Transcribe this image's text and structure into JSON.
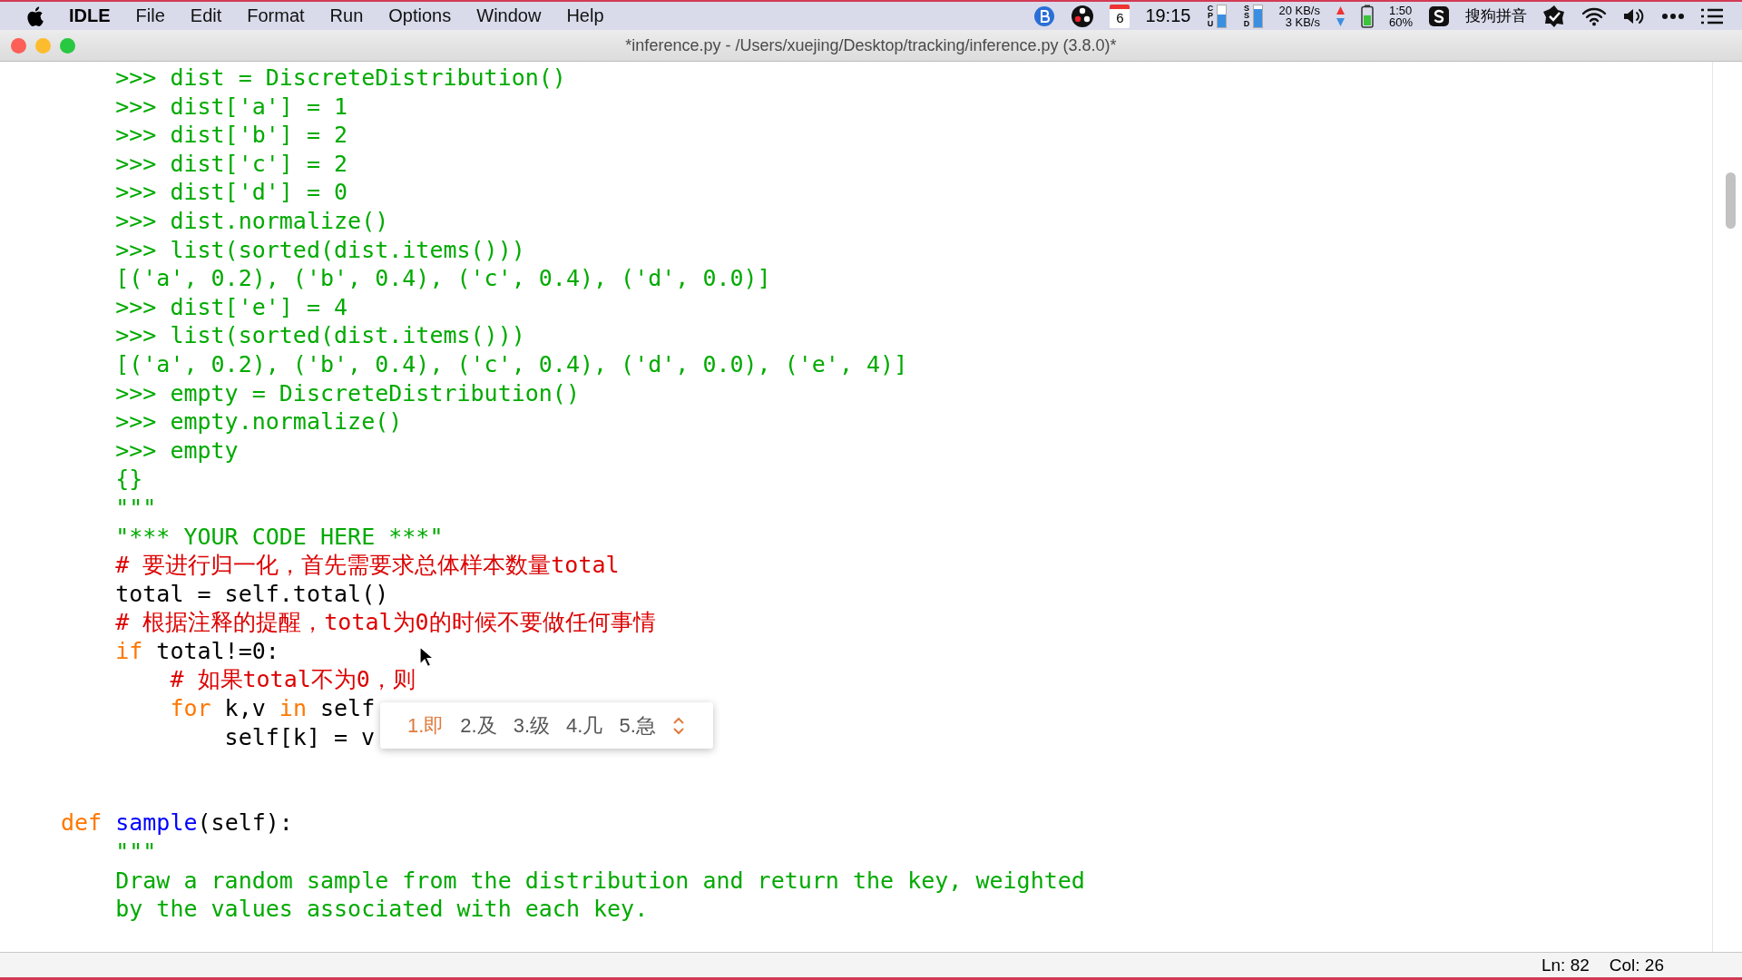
{
  "menu_bar": {
    "app_name": "IDLE",
    "menus": [
      "File",
      "Edit",
      "Format",
      "Run",
      "Options",
      "Window",
      "Help"
    ],
    "status": {
      "calendar_day": "6",
      "clock": "19:15",
      "cpu": {
        "label": "CPU",
        "level": 0.55
      },
      "ssd": {
        "label": "SSD",
        "level": 0.8
      },
      "network": {
        "upload": "20 KB/s",
        "download": "3 KB/s"
      },
      "battery": {
        "level": 0.6,
        "time": "1:50",
        "percent": "60%"
      },
      "input_method": "搜狗拼音"
    }
  },
  "window": {
    "title": "*inference.py - /Users/xuejing/Desktop/tracking/inference.py (3.8.0)*"
  },
  "editor": {
    "lines": [
      {
        "kind": "code",
        "tokens": [
          {
            "kind": "string",
            "text": "    >>> dist = DiscreteDistribution()"
          }
        ]
      },
      {
        "kind": "code",
        "tokens": [
          {
            "kind": "string",
            "text": "    >>> dist['a'] = 1"
          }
        ]
      },
      {
        "kind": "code",
        "tokens": [
          {
            "kind": "string",
            "text": "    >>> dist['b'] = 2"
          }
        ]
      },
      {
        "kind": "code",
        "tokens": [
          {
            "kind": "string",
            "text": "    >>> dist['c'] = 2"
          }
        ]
      },
      {
        "kind": "code",
        "tokens": [
          {
            "kind": "string",
            "text": "    >>> dist['d'] = 0"
          }
        ]
      },
      {
        "kind": "code",
        "tokens": [
          {
            "kind": "string",
            "text": "    >>> dist.normalize()"
          }
        ]
      },
      {
        "kind": "code",
        "tokens": [
          {
            "kind": "string",
            "text": "    >>> list(sorted(dist.items()))"
          }
        ]
      },
      {
        "kind": "code",
        "tokens": [
          {
            "kind": "string",
            "text": "    [('a', 0.2), ('b', 0.4), ('c', 0.4), ('d', 0.0)]"
          }
        ]
      },
      {
        "kind": "code",
        "tokens": [
          {
            "kind": "string",
            "text": "    >>> dist['e'] = 4"
          }
        ]
      },
      {
        "kind": "code",
        "tokens": [
          {
            "kind": "string",
            "text": "    >>> list(sorted(dist.items()))"
          }
        ]
      },
      {
        "kind": "code",
        "tokens": [
          {
            "kind": "string",
            "text": "    [('a', 0.2), ('b', 0.4), ('c', 0.4), ('d', 0.0), ('e', 4)]"
          }
        ]
      },
      {
        "kind": "code",
        "tokens": [
          {
            "kind": "string",
            "text": "    >>> empty = DiscreteDistribution()"
          }
        ]
      },
      {
        "kind": "code",
        "tokens": [
          {
            "kind": "string",
            "text": "    >>> empty.normalize()"
          }
        ]
      },
      {
        "kind": "code",
        "tokens": [
          {
            "kind": "string",
            "text": "    >>> empty"
          }
        ]
      },
      {
        "kind": "code",
        "tokens": [
          {
            "kind": "string",
            "text": "    {}"
          }
        ]
      },
      {
        "kind": "code",
        "tokens": [
          {
            "kind": "string",
            "text": "    \"\"\""
          }
        ]
      },
      {
        "kind": "code",
        "tokens": [
          {
            "kind": "string",
            "text": "    \"*** YOUR CODE HERE ***\""
          }
        ]
      },
      {
        "kind": "code",
        "tokens": [
          {
            "kind": "comment",
            "text": "    # 要进行归一化，首先需要求总体样本数量total"
          }
        ]
      },
      {
        "kind": "code",
        "tokens": [
          {
            "kind": "plain",
            "text": "    total = self.total()"
          }
        ]
      },
      {
        "kind": "code",
        "tokens": [
          {
            "kind": "comment",
            "text": "    # 根据注释的提醒，total为0的时候不要做任何事情"
          }
        ]
      },
      {
        "kind": "code",
        "tokens": [
          {
            "kind": "keyword",
            "text": "    if"
          },
          {
            "kind": "plain",
            "text": " total!=0:"
          }
        ]
      },
      {
        "kind": "code",
        "tokens": [
          {
            "kind": "comment",
            "text": "        # 如果total不为0，则"
          }
        ]
      },
      {
        "kind": "code",
        "tokens": [
          {
            "kind": "keyword",
            "text": "        for"
          },
          {
            "kind": "plain",
            "text": " k,v "
          },
          {
            "kind": "keyword",
            "text": "in"
          },
          {
            "kind": "plain",
            "text": " self"
          }
        ]
      },
      {
        "kind": "code",
        "tokens": [
          {
            "kind": "plain",
            "text": "            self[k] = v"
          }
        ]
      },
      {
        "kind": "blank"
      },
      {
        "kind": "blank"
      },
      {
        "kind": "code",
        "tokens": [
          {
            "kind": "keyword",
            "text": "def "
          },
          {
            "kind": "definition",
            "text": "sample"
          },
          {
            "kind": "plain",
            "text": "(self):"
          }
        ]
      },
      {
        "kind": "code",
        "tokens": [
          {
            "kind": "string",
            "text": "    \"\"\""
          }
        ]
      },
      {
        "kind": "code",
        "tokens": [
          {
            "kind": "string",
            "text": "    Draw a random sample from the distribution and return the key, weighted"
          }
        ]
      },
      {
        "kind": "code",
        "tokens": [
          {
            "kind": "string",
            "text": "    by the values associated with each key."
          }
        ]
      }
    ],
    "ime_popup": {
      "candidates": [
        {
          "text": "1.即",
          "selected": true
        },
        {
          "text": "2.及",
          "selected": false
        },
        {
          "text": "3.级",
          "selected": false
        },
        {
          "text": "4.几",
          "selected": false
        },
        {
          "text": "5.急",
          "selected": false
        }
      ]
    }
  },
  "status_bar": {
    "line": "Ln: 82",
    "column": "Col: 26"
  }
}
